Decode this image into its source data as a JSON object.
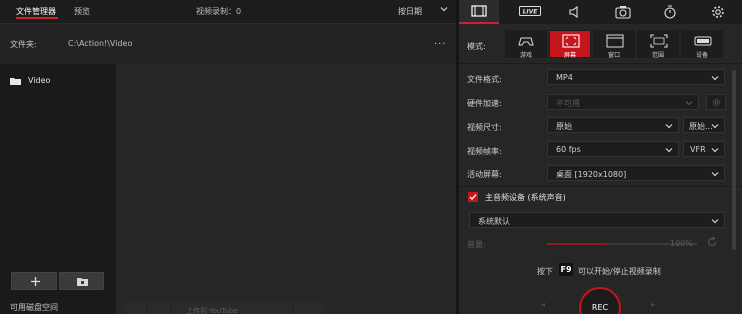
{
  "left": {
    "tabs": [
      "文件管理器",
      "预览"
    ],
    "record_count": "视频录制：0",
    "sort": "按日期",
    "folder": {
      "label": "文件夹:",
      "path": "C:\\Action!\\Video",
      "more": "..."
    },
    "tree": [
      {
        "label": "Video"
      }
    ],
    "tree_buttons": [
      "+",
      "⊞"
    ],
    "disk_label": "可用磁盘空间",
    "bottom_text": "上传到 YouTube"
  },
  "right": {
    "tabs": [
      "video-icon",
      "live-icon",
      "audio-icon",
      "camera-icon",
      "timer-icon",
      "gear-icon"
    ],
    "live_tab_text": "LIVE",
    "mode_label": "模式:",
    "modes": [
      {
        "label": "游戏",
        "icon": "gamepad-icon"
      },
      {
        "label": "屏幕",
        "icon": "screen-icon",
        "active": true
      },
      {
        "label": "窗口",
        "icon": "window-icon"
      },
      {
        "label": "范围",
        "icon": "region-icon"
      },
      {
        "label": "设备",
        "icon": "device-icon"
      }
    ],
    "file_format": {
      "label": "文件格式:",
      "value": "MP4"
    },
    "hw_accel": {
      "label": "硬件加速:",
      "value": "不可用"
    },
    "video_size": {
      "label": "视频尺寸:",
      "value": "原始",
      "value2": "原始..."
    },
    "frame_rate": {
      "label": "视频帧率:",
      "value": "60 fps",
      "value2": "VFR"
    },
    "active_screen": {
      "label": "活动屏幕:",
      "value": "桌面 [1920x1080]"
    },
    "main_audio": {
      "label": "主音频设备 (系统声音)",
      "checked": true
    },
    "audio_device": {
      "value": "系统默认"
    },
    "volume": {
      "label": "音量:",
      "value": "100%",
      "level": 0.4
    },
    "hotkey": {
      "prefix": "按下",
      "key": "F9",
      "suffix": "可以开始/停止视频录制"
    },
    "rec_label": "REC"
  },
  "colors": {
    "accent": "#c4161c",
    "bg": "#262626"
  }
}
